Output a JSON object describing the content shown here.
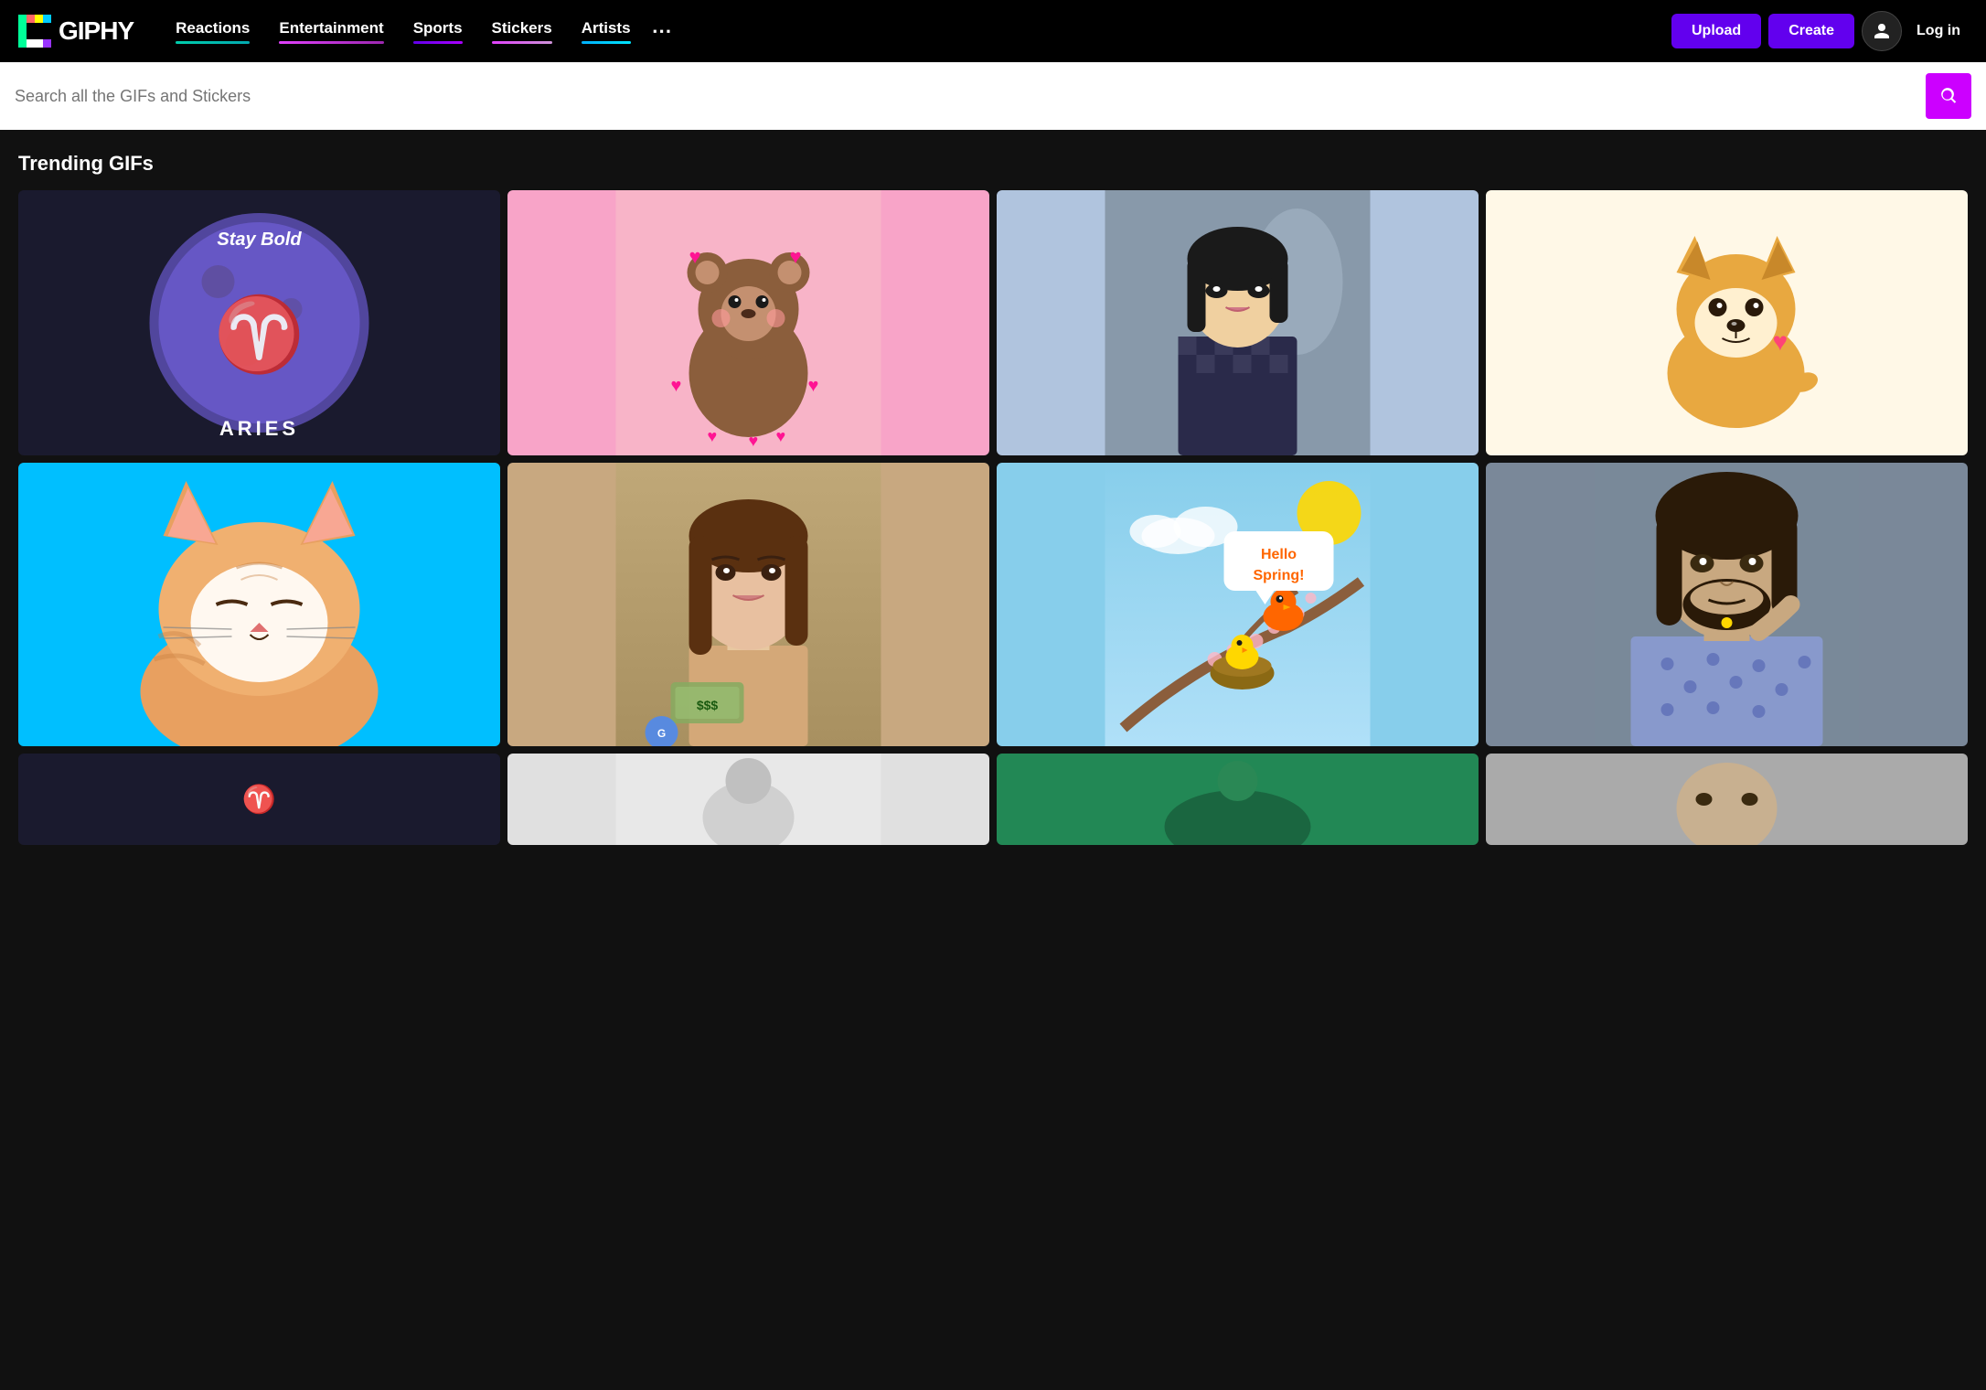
{
  "logo": {
    "text": "GIPHY"
  },
  "nav": {
    "items": [
      {
        "label": "Reactions",
        "color": "cyan"
      },
      {
        "label": "Entertainment",
        "color": "purple"
      },
      {
        "label": "Sports",
        "color": "violet"
      },
      {
        "label": "Stickers",
        "color": "pink"
      },
      {
        "label": "Artists",
        "color": "blue"
      }
    ],
    "more_icon": "⋯",
    "upload_label": "Upload",
    "create_label": "Create",
    "login_label": "Log in"
  },
  "search": {
    "placeholder": "Search all the GIFs and Stickers"
  },
  "trending": {
    "title": "Trending GIFs"
  },
  "gifs": {
    "row1": [
      {
        "id": "r1c1",
        "alt": "Aries Stay Bold moon GIF",
        "bg": "#1a1a2e"
      },
      {
        "id": "r1c2",
        "alt": "Cute bear with hearts GIF",
        "bg": "#f8a4c8"
      },
      {
        "id": "r1c3",
        "alt": "Asian girl looking camera GIF",
        "bg": "#b0c4de"
      },
      {
        "id": "r1c4",
        "alt": "Corgi dog cartoon GIF",
        "bg": "#fff8e7"
      }
    ],
    "row2": [
      {
        "id": "r2c1",
        "alt": "Cat sleeping GIF",
        "bg": "#00bfff"
      },
      {
        "id": "r2c2",
        "alt": "Woman counting money GIF",
        "bg": "#d2a679"
      },
      {
        "id": "r2c3",
        "alt": "Hello Spring bird GIF",
        "bg": "#87ceeb"
      },
      {
        "id": "r2c4",
        "alt": "Jason Momoa GIF",
        "bg": "#8faacc"
      }
    ],
    "row3": [
      {
        "id": "r3c2",
        "alt": "Partial GIF 1",
        "bg": "#ddd"
      },
      {
        "id": "r3c3",
        "alt": "Partial GIF 2",
        "bg": "#444"
      },
      {
        "id": "r3c4",
        "alt": "Partial GIF 3",
        "bg": "#ccc"
      }
    ]
  }
}
